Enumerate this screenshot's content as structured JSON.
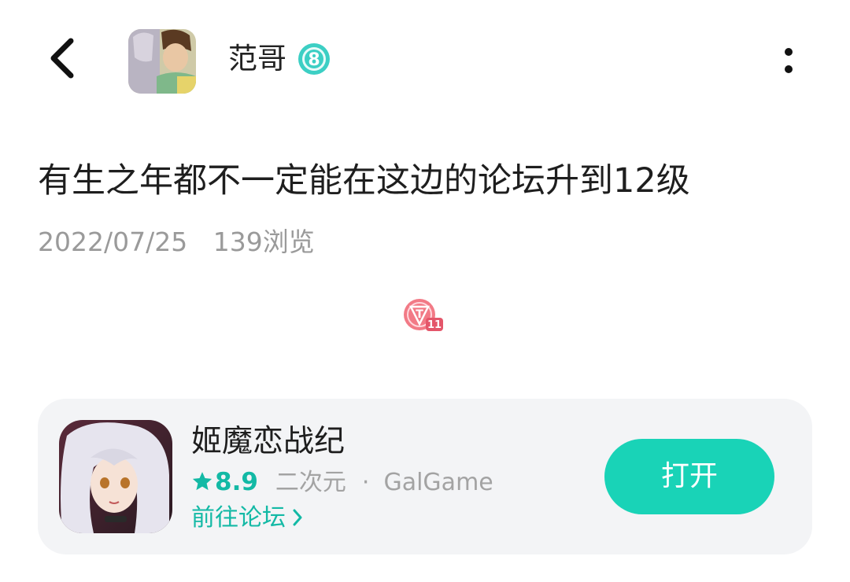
{
  "header": {
    "back_icon": "chevron-left-icon",
    "username": "范哥",
    "level": "8",
    "more_icon": "more-vertical-icon"
  },
  "post": {
    "title": "有生之年都不一定能在这边的论坛升到12级",
    "date": "2022/07/25",
    "views": "139浏览",
    "emoji_badge_label": "T",
    "emoji_badge_number": "11"
  },
  "game": {
    "name": "姬魔恋战纪",
    "rating": "8.9",
    "genre": "二次元",
    "separator": "·",
    "category": "GalGame",
    "forum_link": "前往论坛",
    "open_button": "打开"
  },
  "colors": {
    "accent": "#13b9a5",
    "button": "#19d3b7",
    "card_bg": "#f3f4f6",
    "meta_text": "#9a9a9a",
    "badge_teal": "#3ccfc4"
  }
}
